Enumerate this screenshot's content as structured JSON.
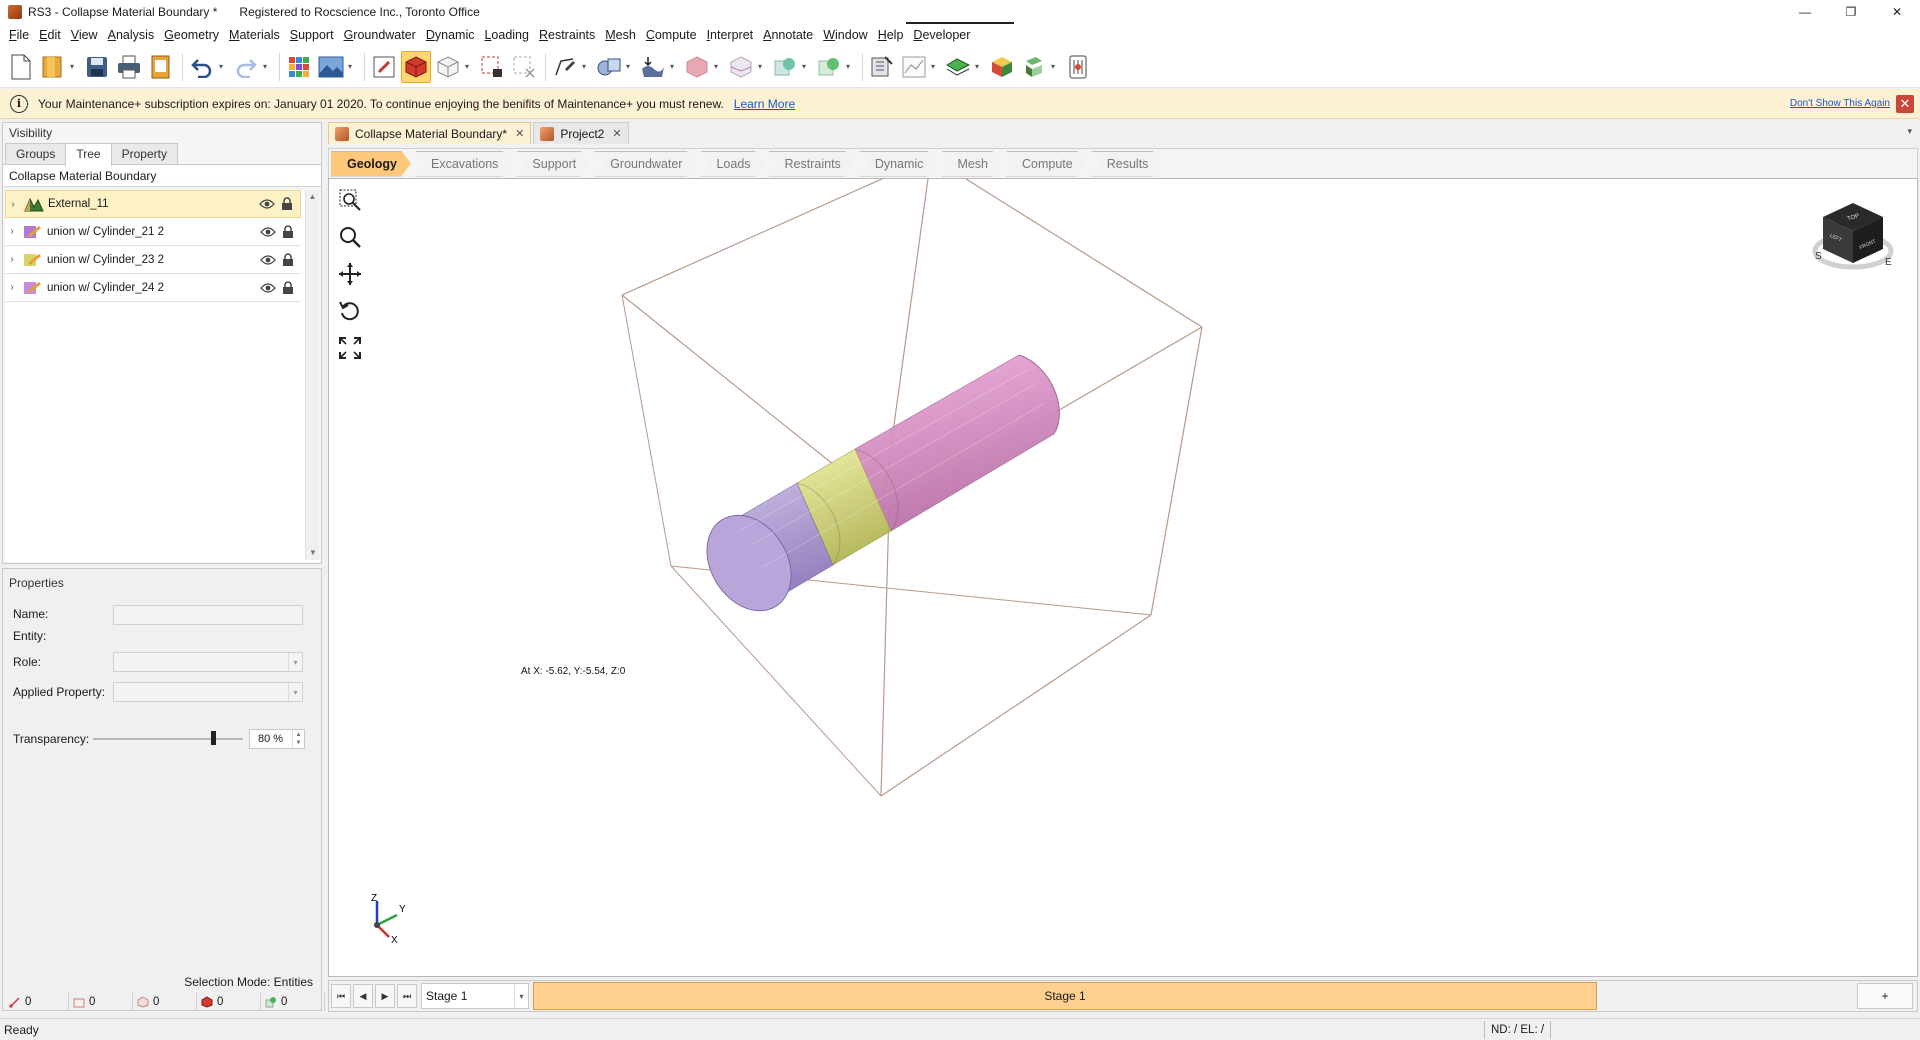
{
  "window": {
    "title": "RS3 - Collapse Material Boundary *",
    "registered": "Registered to Rocscience Inc., Toronto Office",
    "minimize": "—",
    "restore": "❐",
    "close": "✕"
  },
  "menu": [
    "File",
    "Edit",
    "View",
    "Analysis",
    "Geometry",
    "Materials",
    "Support",
    "Groundwater",
    "Dynamic",
    "Loading",
    "Restraints",
    "Mesh",
    "Compute",
    "Interpret",
    "Annotate",
    "Window",
    "Help",
    "Developer"
  ],
  "notification": {
    "message": "Your Maintenance+ subscription expires on: January 01 2020. To continue enjoying the benifits of Maintenance+ you must renew.",
    "learn_more": "Learn More",
    "dont_show": "Don't Show This Again",
    "info_glyph": "i",
    "close_glyph": "✕"
  },
  "visibility_panel": {
    "title": "Visibility",
    "tabs": [
      "Groups",
      "Tree",
      "Property"
    ],
    "active_tab": "Tree",
    "tree_root": "Collapse Material Boundary",
    "items": [
      {
        "label": "External_11",
        "icon": "external-surface-icon",
        "selected": true
      },
      {
        "label": "union w/ Cylinder_21 2",
        "icon": "union-body-icon",
        "selected": false
      },
      {
        "label": "union w/ Cylinder_23 2",
        "icon": "union-body-icon",
        "selected": false
      },
      {
        "label": "union w/ Cylinder_24 2",
        "icon": "union-body-icon",
        "selected": false
      }
    ],
    "expander_glyph": "›"
  },
  "properties_panel": {
    "title": "Properties",
    "name_label": "Name:",
    "entity_label": "Entity:",
    "role_label": "Role:",
    "applied_property_label": "Applied Property:",
    "transparency_label": "Transparency:",
    "transparency_value": "80 %",
    "transparency_fraction": 0.8,
    "selection_mode": "Selection Mode: Entities",
    "counters": [
      "0",
      "0",
      "0",
      "0",
      "0"
    ]
  },
  "doc_tabs": [
    {
      "label": "Collapse Material Boundary*",
      "active": true
    },
    {
      "label": "Project2",
      "active": false
    }
  ],
  "doc_tab_close": "✕",
  "doc_tabs_overflow": "▾",
  "workflow_steps": [
    "Geology",
    "Excavations",
    "Support",
    "Groundwater",
    "Loads",
    "Restraints",
    "Dynamic",
    "Mesh",
    "Compute",
    "Results"
  ],
  "workflow_active": "Geology",
  "viewport": {
    "coordinates": "At X: -5.62, Y:-5.54, Z:0",
    "axis_labels": {
      "x": "X",
      "y": "Y",
      "z": "Z"
    },
    "cube_faces": {
      "top": "TOP",
      "front": "FRONT",
      "left": "LEFT"
    },
    "compass": {
      "s": "S",
      "e": "E"
    },
    "colors": {
      "box_edge": "#b89a8a",
      "segment_a": "#b4a3d6",
      "segment_b": "#dfe38a",
      "segment_c": "#e89ad3"
    }
  },
  "stage_bar": {
    "nav": [
      "⏮",
      "◀",
      "▶",
      "⏭"
    ],
    "selected_stage": "Stage 1",
    "current_stage": "Stage 1",
    "add_label": "+"
  },
  "status": {
    "ready": "Ready",
    "nd_el": "ND: /  EL: /"
  }
}
